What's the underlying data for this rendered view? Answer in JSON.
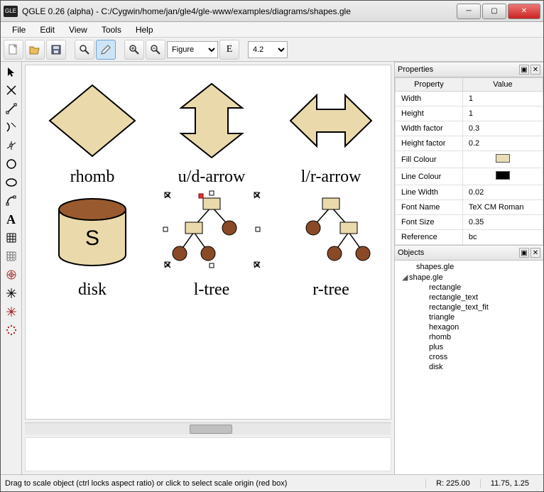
{
  "app": {
    "title": "QGLE 0.26 (alpha) - C:/Cygwin/home/jan/gle4/gle-www/examples/diagrams/shapes.gle",
    "icon_text": "GLE"
  },
  "menu": {
    "items": [
      "File",
      "Edit",
      "View",
      "Tools",
      "Help"
    ]
  },
  "toolbar": {
    "figure_select": "Figure",
    "zoom_select": "4.2"
  },
  "shapes": {
    "labels": [
      "rhomb",
      "u/d-arrow",
      "l/r-arrow",
      "disk",
      "l-tree",
      "r-tree"
    ]
  },
  "properties": {
    "title": "Properties",
    "headers": [
      "Property",
      "Value"
    ],
    "rows": [
      {
        "k": "Width",
        "v": "1"
      },
      {
        "k": "Height",
        "v": "1"
      },
      {
        "k": "Width factor",
        "v": "0.3"
      },
      {
        "k": "Height factor",
        "v": "0.2"
      },
      {
        "k": "Fill Colour",
        "v": "",
        "color": "#eadcb5"
      },
      {
        "k": "Line Colour",
        "v": "",
        "color": "#000000"
      },
      {
        "k": "Line Width",
        "v": "0.02"
      },
      {
        "k": "Font Name",
        "v": "TeX CM Roman"
      },
      {
        "k": "Font Size",
        "v": "0.35"
      },
      {
        "k": "Reference",
        "v": "bc"
      }
    ]
  },
  "objects": {
    "title": "Objects",
    "items": [
      {
        "level": 0,
        "text": "shapes.gle",
        "exp": ""
      },
      {
        "level": 1,
        "text": "shape.gle",
        "exp": "◢"
      },
      {
        "level": 2,
        "text": "rectangle"
      },
      {
        "level": 2,
        "text": "rectangle_text"
      },
      {
        "level": 2,
        "text": "rectangle_text_fit"
      },
      {
        "level": 2,
        "text": "triangle"
      },
      {
        "level": 2,
        "text": "hexagon"
      },
      {
        "level": 2,
        "text": "rhomb"
      },
      {
        "level": 2,
        "text": "plus"
      },
      {
        "level": 2,
        "text": "cross"
      },
      {
        "level": 2,
        "text": "disk"
      }
    ]
  },
  "status": {
    "hint": "Drag to scale object (ctrl locks aspect ratio) or click to select scale origin (red box)",
    "r": "R:  225.00",
    "coords": "11.75, 1.25"
  }
}
